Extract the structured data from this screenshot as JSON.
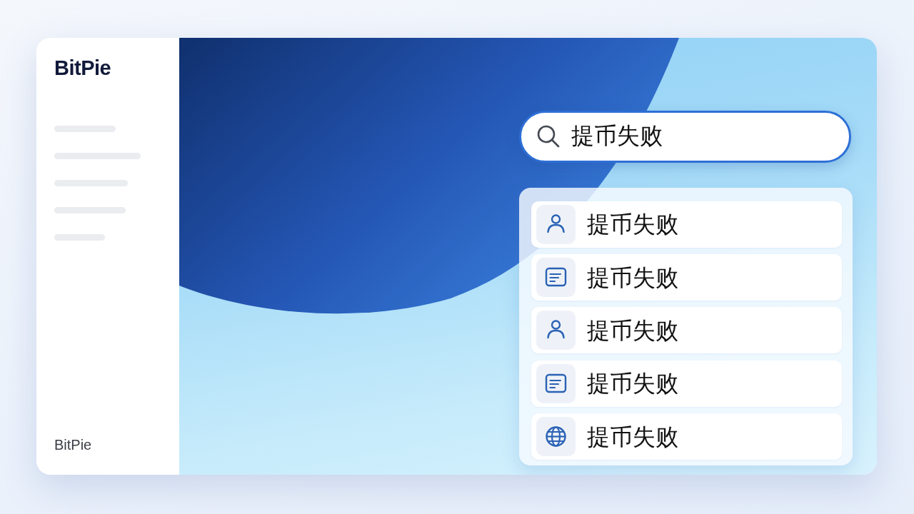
{
  "sidebar": {
    "logo": "BitPie",
    "footer": "BitPie"
  },
  "search": {
    "value": "提币失败"
  },
  "results": [
    {
      "kind": "person",
      "label": "提币失败"
    },
    {
      "kind": "document",
      "label": "提币失败"
    },
    {
      "kind": "person",
      "label": "提币失败"
    },
    {
      "kind": "document",
      "label": "提币失败"
    },
    {
      "kind": "globe",
      "label": "提币失败"
    }
  ]
}
